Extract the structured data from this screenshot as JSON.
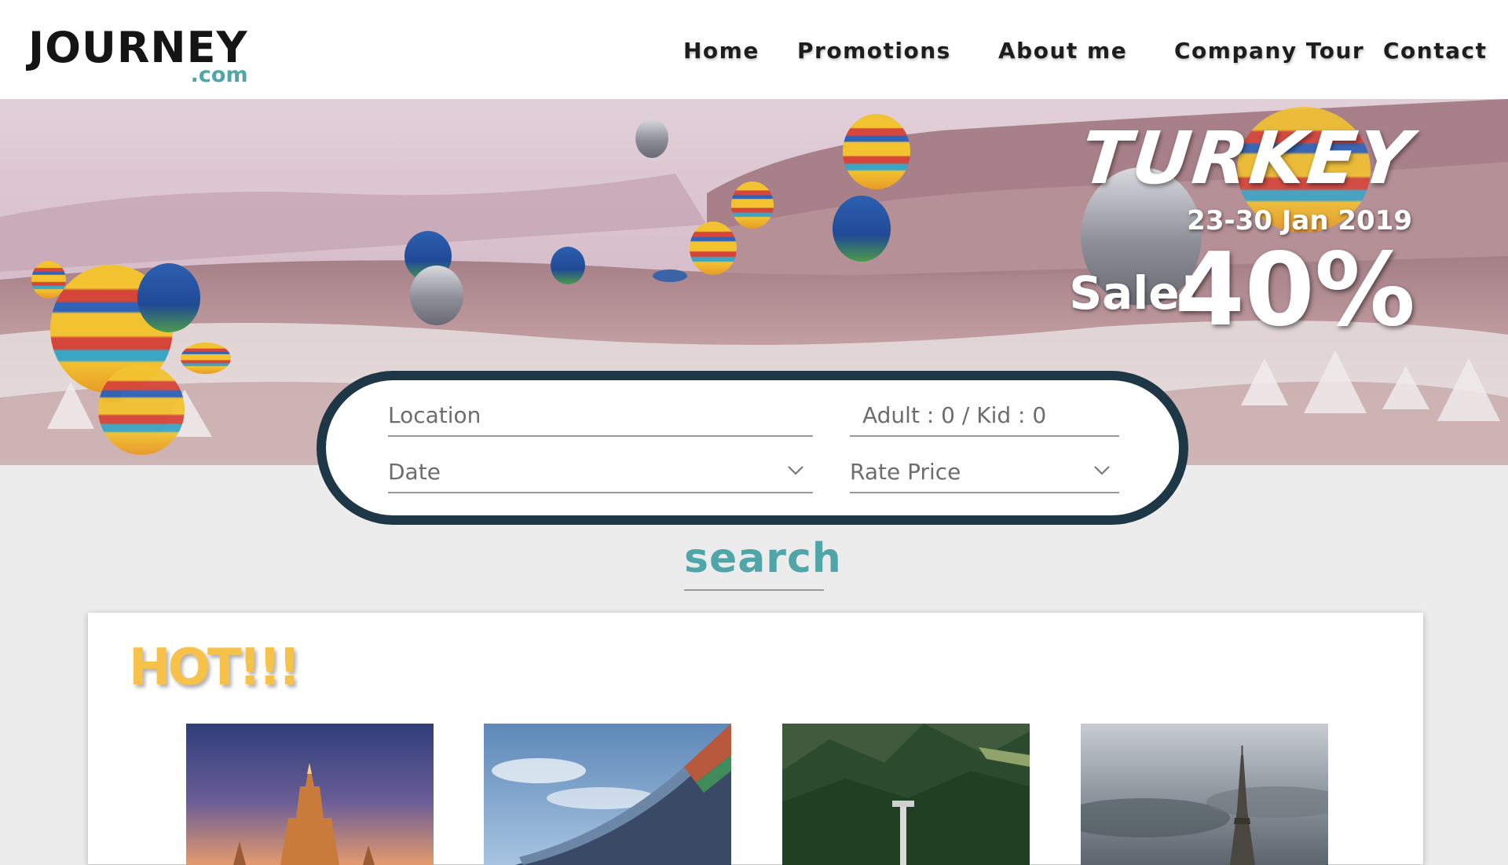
{
  "logo": {
    "main": "JOURNEY",
    "sub": ".com"
  },
  "nav": {
    "items": [
      "Home",
      "Promotions",
      "About me",
      "Company Tour",
      "Contact"
    ]
  },
  "hero": {
    "promo": {
      "title": "TURKEY",
      "dates": "23-30 Jan 2019",
      "sale_label": "Sale!",
      "discount": "40%"
    },
    "image": "hot-air-balloons-over-valley"
  },
  "search_form": {
    "location_placeholder": "Location",
    "guests_text": "Adult : 0  / Kid : 0",
    "date_placeholder": "Date",
    "rate_placeholder": "Rate Price",
    "dropdown_icon": "chevron-down-icon"
  },
  "search_button": {
    "label": "search"
  },
  "hot_section": {
    "title": "HOT!!!",
    "destinations": [
      {
        "image": "temple-spire-at-dusk"
      },
      {
        "image": "traditional-pagoda-roof"
      },
      {
        "image": "forest-mountain-valley"
      },
      {
        "image": "eiffel-tower-cloudy-sky"
      }
    ]
  },
  "colors": {
    "accent": "#4fa5a7",
    "panel_border": "#1e3747",
    "hot": "#f6c24a",
    "page_bg": "#ececec"
  }
}
